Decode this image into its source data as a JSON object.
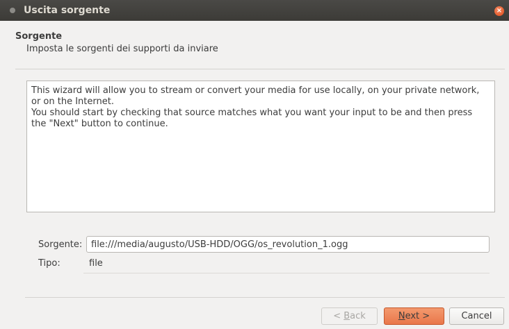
{
  "window": {
    "title": "Uscita sorgente",
    "close_symbol": "×"
  },
  "section": {
    "title": "Sorgente",
    "subtitle": "Imposta le sorgenti dei supporti da inviare"
  },
  "description": "This wizard will allow you to stream or convert your media for use locally, on your private network,\nor on the Internet.\nYou should start by checking that source matches what you want your input to be and then press\nthe \"Next\" button to continue.",
  "source": {
    "label": "Sorgente:",
    "value": "file:///media/augusto/USB-HDD/OGG/os_revolution_1.ogg"
  },
  "type": {
    "label": "Tipo:",
    "value": "file"
  },
  "buttons": {
    "back_prefix": "< ",
    "back_mnemonic": "B",
    "back_rest": "ack",
    "next_mnemonic": "N",
    "next_rest": "ext >",
    "cancel": "Cancel"
  },
  "colors": {
    "accent": "#e9774a",
    "titlebar": "#3c3b37",
    "close": "#df4a16"
  }
}
